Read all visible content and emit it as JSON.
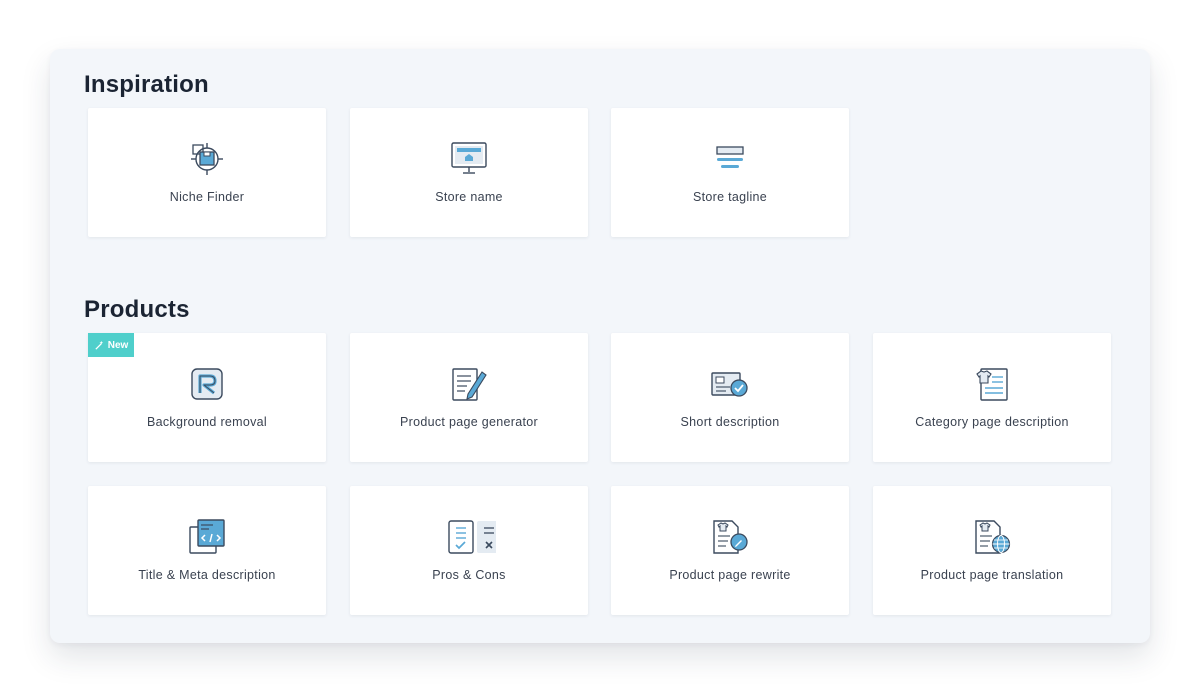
{
  "sections": {
    "inspiration": {
      "title": "Inspiration",
      "cards": [
        {
          "label": "Niche Finder",
          "icon": "niche-finder-icon"
        },
        {
          "label": "Store name",
          "icon": "store-monitor-icon"
        },
        {
          "label": "Store tagline",
          "icon": "tagline-lines-icon"
        }
      ]
    },
    "products": {
      "title": "Products",
      "badge": "New",
      "cards": [
        {
          "label": "Background removal",
          "icon": "background-removal-icon"
        },
        {
          "label": "Product page generator",
          "icon": "document-pen-icon"
        },
        {
          "label": "Short description",
          "icon": "short-description-icon"
        },
        {
          "label": "Category page description",
          "icon": "category-page-icon"
        },
        {
          "label": "Title & Meta description",
          "icon": "code-window-icon"
        },
        {
          "label": "Pros & Cons",
          "icon": "pros-cons-icon"
        },
        {
          "label": "Product page rewrite",
          "icon": "page-rewrite-icon"
        },
        {
          "label": "Product page translation",
          "icon": "page-translation-icon"
        }
      ]
    }
  },
  "colors": {
    "accent_blue": "#5aa9d6",
    "badge_teal": "#4fcfcb",
    "icon_stroke": "#3b4a5e",
    "panel_bg": "#f3f6fa"
  }
}
